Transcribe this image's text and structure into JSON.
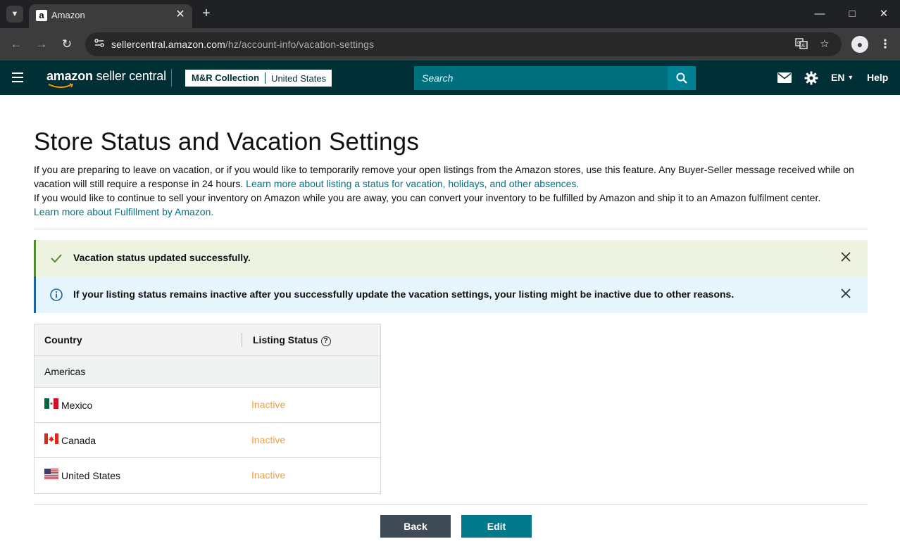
{
  "browser": {
    "tab_title": "Amazon",
    "favicon_letter": "a",
    "url_host": "sellercentral.amazon.com",
    "url_path": "/hz/account-info/vacation-settings"
  },
  "header": {
    "logo_bold": "amazon",
    "logo_rest": " seller central",
    "store_name": "M&R Collection",
    "marketplace": "United States",
    "search_placeholder": "Search",
    "language": "EN",
    "help": "Help"
  },
  "page": {
    "title": "Store Status and Vacation Settings",
    "intro_1": "If you are preparing to leave on vacation, or if you would like to temporarily remove your open listings from the Amazon stores, use this feature. Any Buyer-Seller message received while on vacation will still require a response in 24 hours. ",
    "intro_link_1": "Learn more about listing a status for vacation, holidays, and other absences.",
    "intro_2": "If you would like to continue to sell your inventory on Amazon while you are away, you can convert your inventory to be fulfilled by Amazon and ship it to an Amazon fulfilment center.",
    "intro_link_2": "Learn more about Fulfillment by Amazon."
  },
  "alerts": {
    "success": "Vacation status updated successfully.",
    "info": "If your listing status remains inactive after you successfully update the vacation settings, your listing might be inactive due to other reasons."
  },
  "table": {
    "col_country": "Country",
    "col_status": "Listing Status",
    "group": "Americas",
    "rows": [
      {
        "country": "Mexico",
        "status": "Inactive"
      },
      {
        "country": "Canada",
        "status": "Inactive"
      },
      {
        "country": "United States",
        "status": "Inactive"
      }
    ]
  },
  "buttons": {
    "back": "Back",
    "edit": "Edit"
  },
  "colors": {
    "header_bg": "#002f36",
    "link": "#007185",
    "inactive": "#f0a040",
    "edit_button": "#00798a",
    "back_button": "#3e4a56"
  }
}
